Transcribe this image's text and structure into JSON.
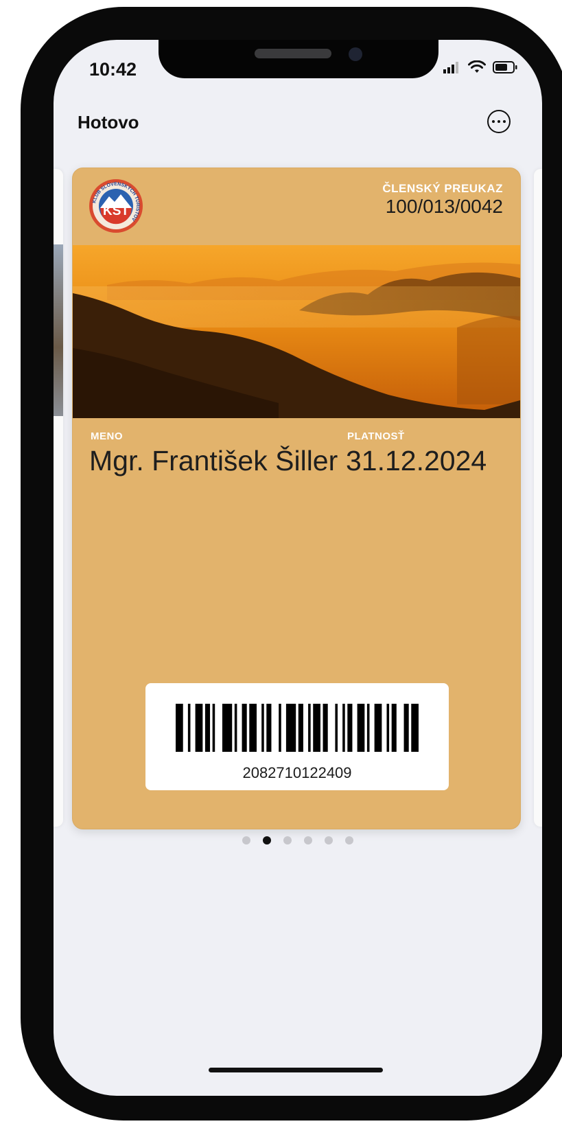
{
  "status_bar": {
    "time": "10:42"
  },
  "nav": {
    "done_label": "Hotovo",
    "more_icon": "ellipsis-circle-icon"
  },
  "pass": {
    "logo_text": "KST",
    "logo_ring_text": "KLUB SLOVENSKÝCH TURISTOV",
    "header_label": "ČLENSKÝ PREUKAZ",
    "header_value": "100/013/0042",
    "fields": [
      {
        "label": "MENO",
        "value": "Mgr. František Šiller"
      },
      {
        "label": "PLATNOSŤ",
        "value": "31.12.2024"
      }
    ],
    "barcode_number": "2082710122409",
    "background_color": "#e2b36c"
  },
  "pager": {
    "count": 6,
    "active_index": 1
  }
}
